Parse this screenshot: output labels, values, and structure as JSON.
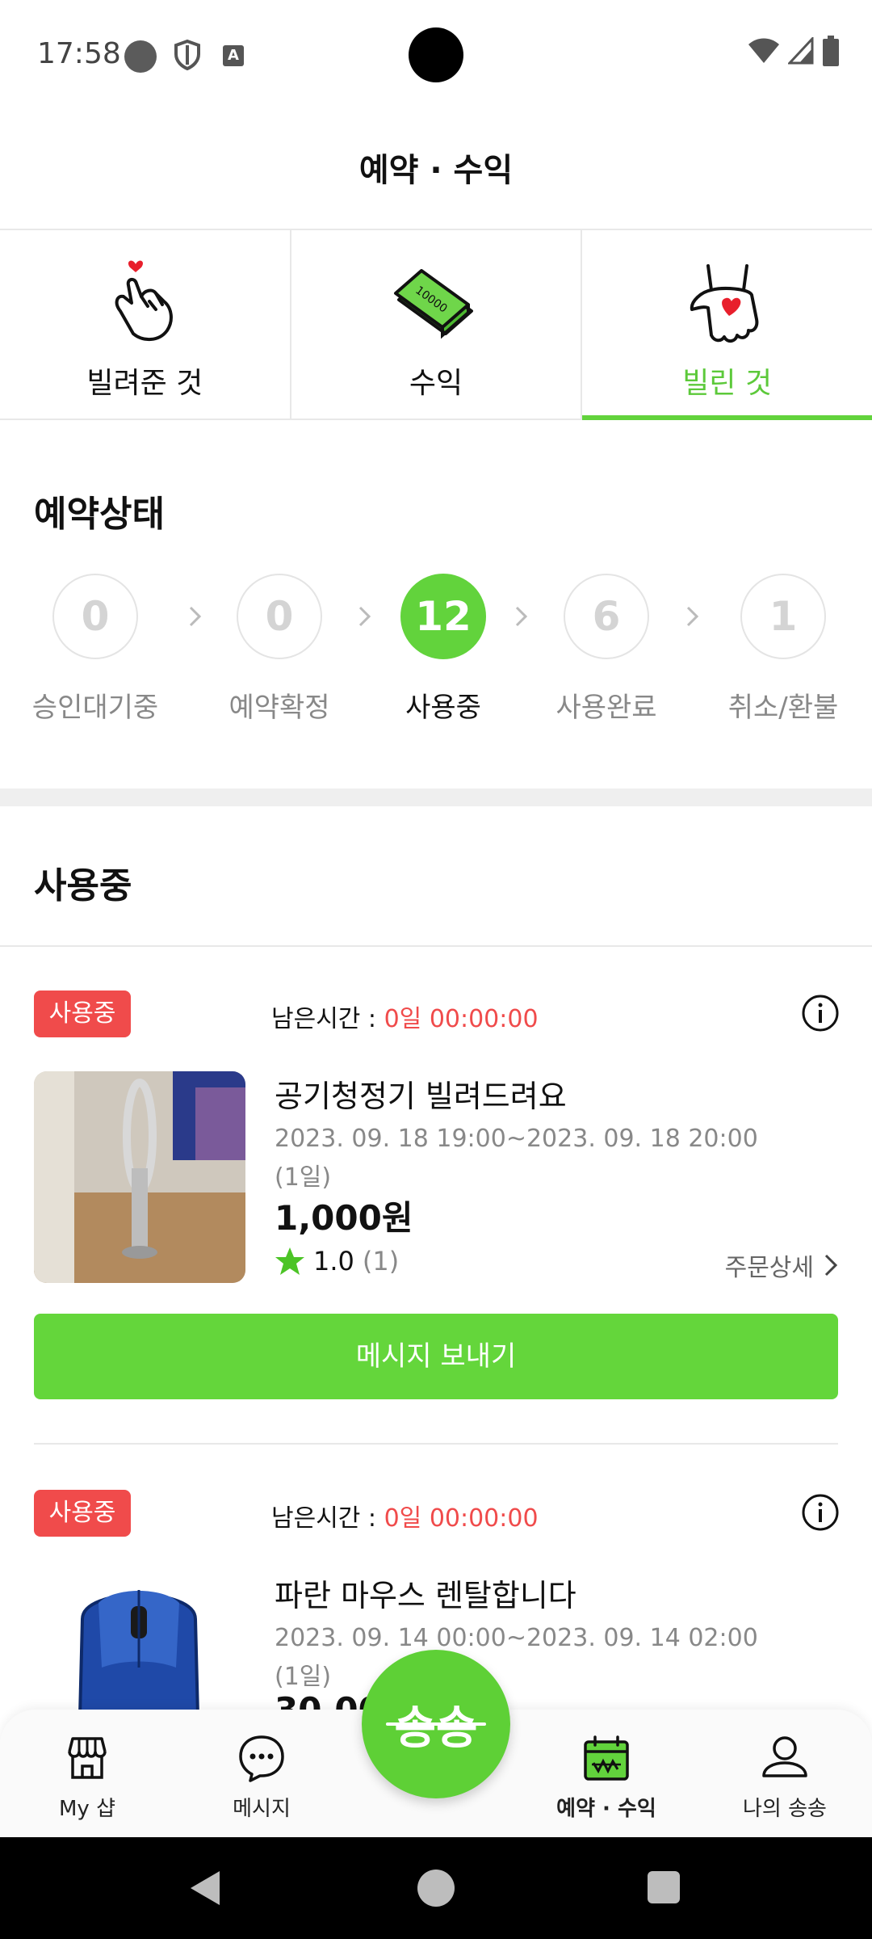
{
  "status_bar": {
    "time": "17:58",
    "icons": [
      "circle-icon",
      "shield-icon",
      "a-icon",
      "wifi-icon",
      "signal-icon",
      "battery-icon"
    ]
  },
  "header": {
    "title": "예약 · 수익"
  },
  "tabs": [
    {
      "label": "빌려준 것",
      "icon": "finger-heart-icon",
      "active": false
    },
    {
      "label": "수익",
      "icon": "money-icon",
      "active": false
    },
    {
      "label": "빌린 것",
      "icon": "hand-heart-icon",
      "active": true
    }
  ],
  "reservation_status": {
    "title": "예약상태",
    "steps": [
      {
        "count": "0",
        "label": "승인대기중",
        "active": false
      },
      {
        "count": "0",
        "label": "예약확정",
        "active": false
      },
      {
        "count": "12",
        "label": "사용중",
        "active": true
      },
      {
        "count": "6",
        "label": "사용완료",
        "active": false
      },
      {
        "count": "1",
        "label": "취소/환불",
        "active": false
      }
    ]
  },
  "list": {
    "title": "사용중",
    "items": [
      {
        "badge": "사용중",
        "remaining_label": "남은시간 :",
        "remaining_value": "0일 00:00:00",
        "title": "공기청정기 빌려드려요",
        "date": "2023. 09. 18 19:00~2023. 09. 18 20:00",
        "days": "(1일)",
        "price": "1,000원",
        "rating": "1.0",
        "rating_count": "(1)",
        "order_detail": "주문상세",
        "message_button": "메시지 보내기"
      },
      {
        "badge": "사용중",
        "remaining_label": "남은시간 :",
        "remaining_value": "0일 00:00:00",
        "title": "파란 마우스 렌탈합니다",
        "date": "2023. 09. 14 00:00~2023. 09. 14 02:00",
        "days": "(1일)",
        "price": "30,00"
      }
    ]
  },
  "bottom_nav": [
    {
      "label": "My 샵",
      "icon": "shop-icon"
    },
    {
      "label": "메시지",
      "icon": "message-icon"
    },
    {
      "label": "송송",
      "icon": "songsong-logo"
    },
    {
      "label": "예약 · 수익",
      "icon": "calendar-money-icon",
      "active": true
    },
    {
      "label": "나의 송송",
      "icon": "profile-icon"
    }
  ],
  "colors": {
    "accent": "#62d33c",
    "badge": "#f04b4b",
    "muted": "#888888"
  }
}
